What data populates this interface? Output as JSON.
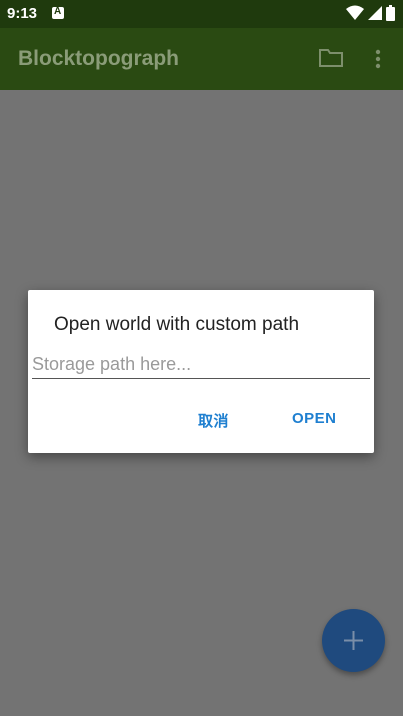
{
  "status_bar": {
    "time": "9:13",
    "icons": [
      "notification-a-icon",
      "wifi-icon",
      "signal-icon",
      "battery-icon"
    ]
  },
  "app_bar": {
    "title": "Blocktopograph",
    "actions": [
      "folder-icon",
      "more-vert-icon"
    ]
  },
  "dialog": {
    "title": "Open world with custom path",
    "input": {
      "value": "",
      "placeholder": "Storage path here..."
    },
    "cancel_label": "取消",
    "open_label": "OPEN"
  },
  "fab": {
    "icon": "plus-icon"
  },
  "colors": {
    "status_bar": "#1f3a0d",
    "app_bar": "#2a4a12",
    "scrim": "#737373",
    "accent": "#1e7fd0",
    "fab": "#1f4a7e"
  }
}
